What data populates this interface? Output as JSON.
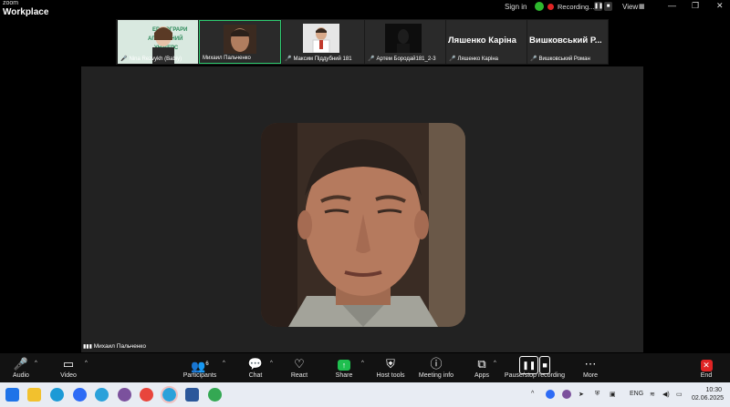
{
  "titlebar": {
    "logo_top": "zoom",
    "logo_bottom": "Workplace",
    "sign_in": "Sign in",
    "recording": "Recording...",
    "view": "View"
  },
  "thumbnails": [
    {
      "name": "Nina Rezvykh (Babiy)",
      "muted": true
    },
    {
      "name": "Михаил Пальченко",
      "muted": false,
      "active": true
    },
    {
      "name": "Максим Піддубний 181",
      "muted": true
    },
    {
      "name": "Артем Бородай181_2-3",
      "muted": true
    },
    {
      "name": "Ляшенко Каріна",
      "muted": true,
      "display_name": "Ляшенко Каріна"
    },
    {
      "name": "Вишковський Роман",
      "muted": true,
      "display_name": "Вишковський  Р..."
    }
  ],
  "stage": {
    "speaker_name": "Михаил Пальченко"
  },
  "toolbar": {
    "audio": "Audio",
    "video": "Video",
    "participants": "Participants",
    "participants_count": "6",
    "chat": "Chat",
    "react": "React",
    "share": "Share",
    "host_tools": "Host tools",
    "meeting_info": "Meeting info",
    "apps": "Apps",
    "pause_stop": "Pause/stop recording",
    "more": "More",
    "end": "End"
  },
  "taskbar": {
    "lang": "ENG",
    "time": "10:30",
    "date": "02.06.2025"
  },
  "colors": {
    "accent_green": "#2ecc71",
    "record_red": "#e02424",
    "share_green": "#1fbf4f"
  }
}
